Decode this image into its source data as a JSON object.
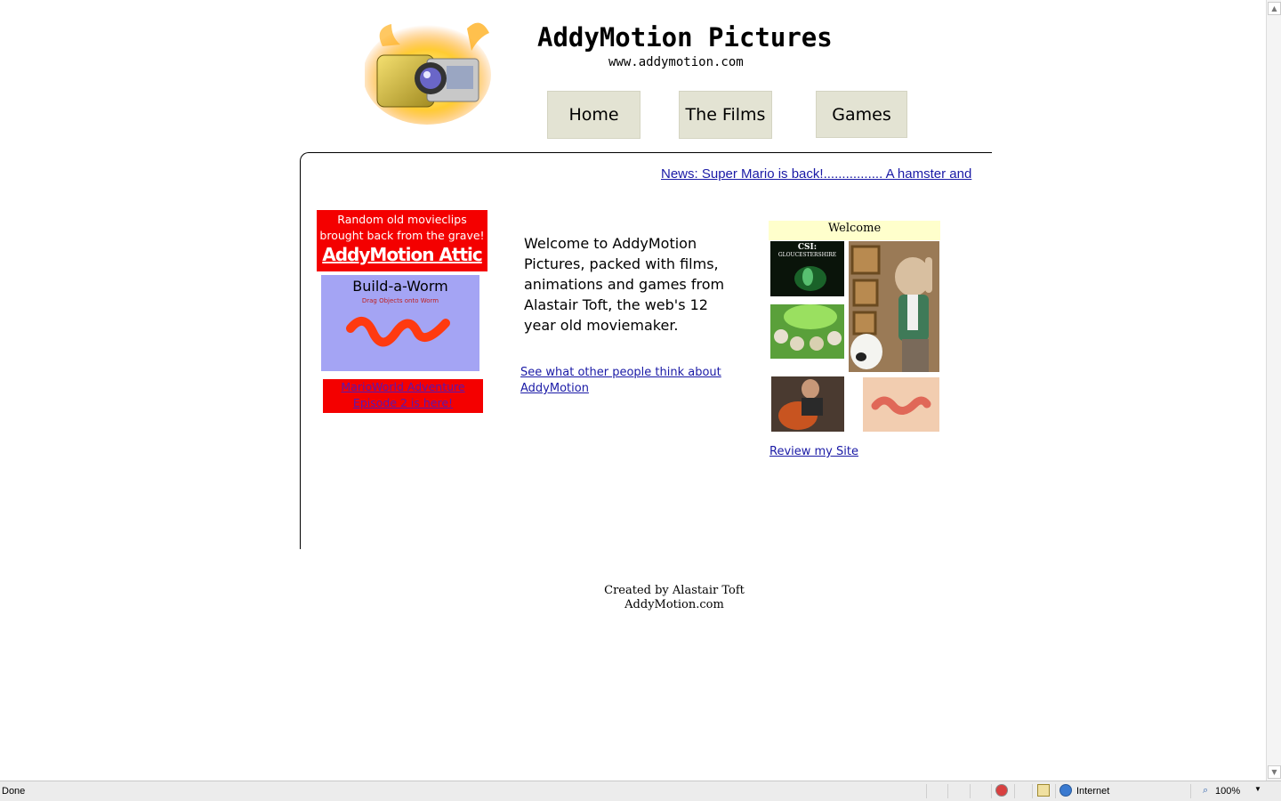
{
  "site": {
    "title": "AddyMotion  Pictures",
    "url_text": "www.addymotion.com"
  },
  "nav": {
    "home": "Home",
    "films": "The Films",
    "games": "Games"
  },
  "news": {
    "text": "News: Super Mario is back!................ A hamster and "
  },
  "sidebar": {
    "attic_line1": "Random old movieclips",
    "attic_line2": "brought back from the grave!",
    "attic_title": "AddyMotion Attic",
    "worm_title": "Build-a-Worm",
    "worm_subtitle": "Drag Objects onto Worm",
    "mario_line1": "MarioWorld Adventure",
    "mario_line2": "Episode 2 is here!"
  },
  "main": {
    "welcome": "Welcome to AddyMotion Pictures, packed with films, animations and games from Alastair Toft, the web's 12 year old moviemaker.",
    "others_link": "See what other people think about AddyMotion"
  },
  "gallery": {
    "header": "Welcome",
    "csi_title": "CSI:",
    "csi_sub": "GLOUCESTERSHIRE",
    "review_link": "Review my Site"
  },
  "footer": {
    "line1": "Created by Alastair Toft",
    "line2": "AddyMotion.com"
  },
  "statusbar": {
    "status": "Done",
    "zone": "Internet",
    "zoom": "100%"
  },
  "colors": {
    "nav_bg": "#e3e3d3",
    "red_panel": "#f40000",
    "worm_bg": "#a4a4f4",
    "welcome_bg": "#ffffcc",
    "link": "#1a1aa6"
  }
}
